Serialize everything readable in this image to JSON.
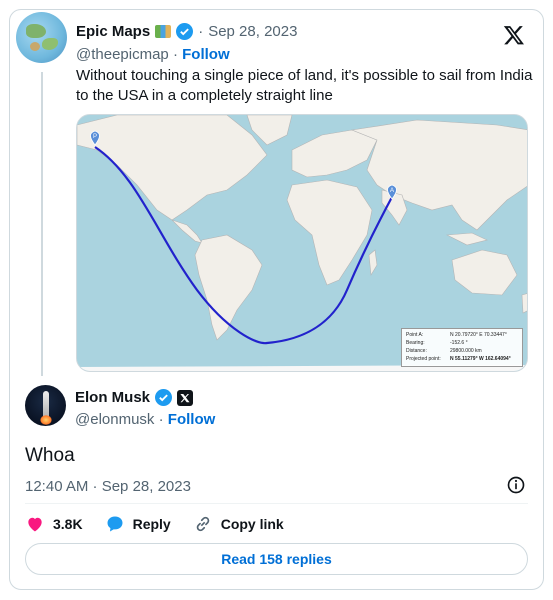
{
  "quoted": {
    "name": "Epic Maps",
    "date": "Sep 28, 2023",
    "handle": "@theepicmap",
    "follow": "Follow",
    "text": "Without touching a single piece of land, it's possible to sail from India to the USA in a completely straight line"
  },
  "map_info": {
    "rows": [
      {
        "k": "Point A:",
        "v": "N 20.79720° E 70.33447°"
      },
      {
        "k": "Bearing:",
        "v": "-152.6 °"
      },
      {
        "k": "Distance:",
        "v": "29800.000 km"
      },
      {
        "k": "Projected point:",
        "v": "N 55.11279° W 162.64094°"
      }
    ],
    "marker_a": "A",
    "marker_p": "P"
  },
  "main": {
    "name": "Elon Musk",
    "handle": "@elonmusk",
    "follow": "Follow",
    "text": "Whoa",
    "timestamp": "12:40 AM · Sep 28, 2023"
  },
  "actions": {
    "likes": "3.8K",
    "reply": "Reply",
    "copy_link": "Copy link",
    "read_replies": "Read 158 replies"
  },
  "colors": {
    "accent": "#1d9bf0",
    "link": "#006fd6",
    "heart": "#f91880",
    "route": "#2222cc"
  }
}
